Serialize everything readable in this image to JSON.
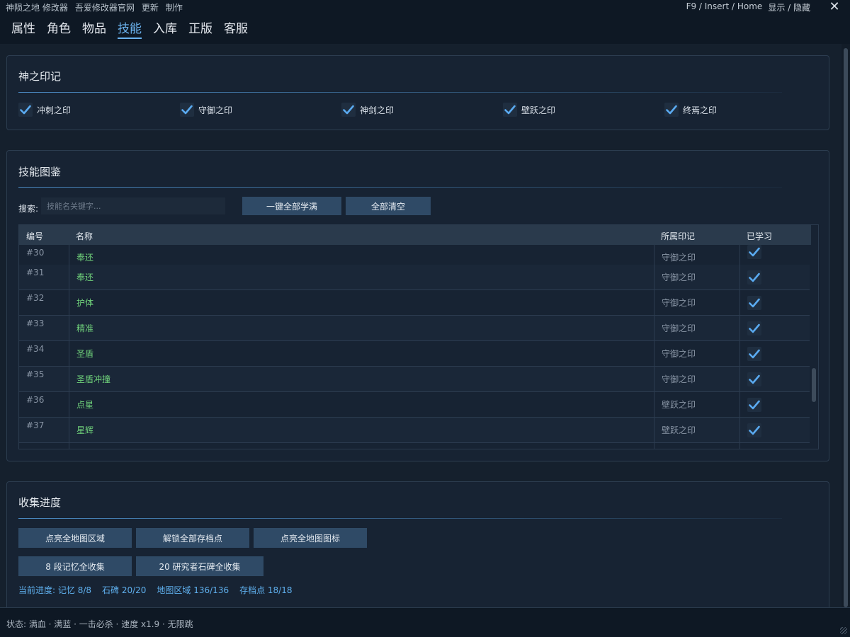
{
  "app": {
    "menu": [
      "神陨之地 修改器",
      "吾爱修改器官网",
      "更新",
      "制作"
    ],
    "hotkey": "F9 / Insert / Home",
    "toggle": "显示 / 隐藏",
    "close": "✕"
  },
  "tabs": [
    {
      "label": "属性",
      "active": false
    },
    {
      "label": "角色",
      "active": false
    },
    {
      "label": "物品",
      "active": false
    },
    {
      "label": "技能",
      "active": true
    },
    {
      "label": "入库",
      "active": false
    },
    {
      "label": "正版",
      "active": false
    },
    {
      "label": "客服",
      "active": false
    }
  ],
  "marks_panel": {
    "title": "神之印记",
    "items": [
      {
        "label": "冲刺之印",
        "checked": true
      },
      {
        "label": "守御之印",
        "checked": true
      },
      {
        "label": "神剑之印",
        "checked": true
      },
      {
        "label": "壁跃之印",
        "checked": true
      },
      {
        "label": "终焉之印",
        "checked": true
      }
    ]
  },
  "skills_panel": {
    "title": "技能图鉴",
    "search_label": "搜索:",
    "search_placeholder": "技能名关键字...",
    "learn_all": "一键全部学满",
    "clear_all": "全部清空",
    "columns": {
      "id": "编号",
      "name": "名称",
      "mark": "所属印记",
      "learned": "已学习"
    },
    "rows": [
      {
        "id": "#30",
        "name": "奉还",
        "mark": "守御之印",
        "learned": true
      },
      {
        "id": "#31",
        "name": "奉还",
        "mark": "守御之印",
        "learned": true
      },
      {
        "id": "#32",
        "name": "护体",
        "mark": "守御之印",
        "learned": true
      },
      {
        "id": "#33",
        "name": "精准",
        "mark": "守御之印",
        "learned": true
      },
      {
        "id": "#34",
        "name": "圣盾",
        "mark": "守御之印",
        "learned": true
      },
      {
        "id": "#35",
        "name": "圣盾冲撞",
        "mark": "守御之印",
        "learned": true
      },
      {
        "id": "#36",
        "name": "点星",
        "mark": "壁跃之印",
        "learned": true
      },
      {
        "id": "#37",
        "name": "星辉",
        "mark": "壁跃之印",
        "learned": true
      }
    ]
  },
  "collection_panel": {
    "title": "收集进度",
    "buttons_row1": [
      "点亮全地图区域",
      "解锁全部存档点",
      "点亮全地图图标"
    ],
    "buttons_row2": [
      "8 段记忆全收集",
      "20 研究者石碑全收集"
    ],
    "progress": {
      "label": "当前进度:",
      "memory": "记忆 8/8",
      "tablets": "石碑 20/20",
      "regions": "地图区域 136/136",
      "savepoints": "存档点 18/18"
    }
  },
  "status": "状态: 满血 · 满蓝 · 一击必杀 · 速度 x1.9 · 无限跳",
  "colors": {
    "accent": "#6cb4f0",
    "skill_name": "#6fd07a",
    "button": "#2f4a66",
    "check": "#5aaaf0"
  }
}
